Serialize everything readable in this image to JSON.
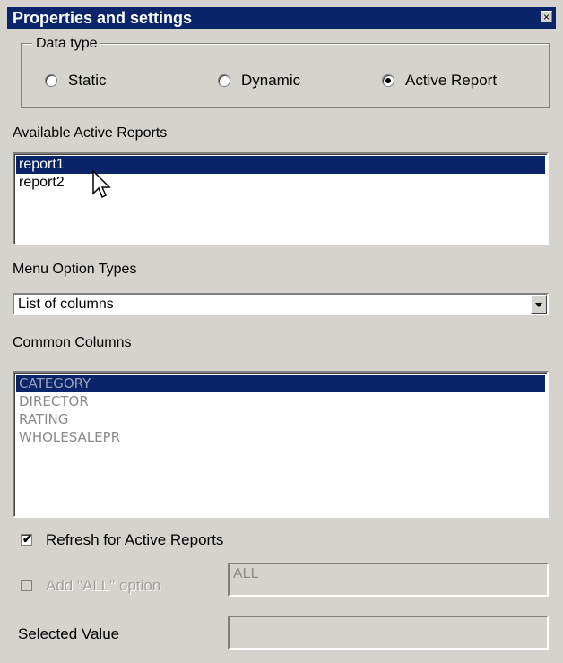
{
  "window": {
    "title": "Properties and settings",
    "close_glyph": "×"
  },
  "data_type": {
    "legend": "Data type",
    "options": [
      {
        "label": "Static",
        "selected": false
      },
      {
        "label": "Dynamic",
        "selected": false
      },
      {
        "label": "Active Report",
        "selected": true
      }
    ]
  },
  "available_reports": {
    "label": "Available Active Reports",
    "items": [
      "report1",
      "report2"
    ],
    "selected_index": 0
  },
  "menu_option_types": {
    "label": "Menu Option Types",
    "value": "List of columns"
  },
  "common_columns": {
    "label": "Common Columns",
    "items": [
      "CATEGORY",
      "DIRECTOR",
      "RATING",
      "WHOLESALEPR"
    ],
    "selected_index": 0
  },
  "refresh_checkbox": {
    "label": "Refresh for Active Reports",
    "checked": true
  },
  "add_all": {
    "label": "Add \"ALL\" option",
    "checked": false,
    "enabled": false,
    "field_value": "ALL"
  },
  "selected_value": {
    "label": "Selected Value",
    "value": ""
  },
  "colors": {
    "title_bar": "#0a246a",
    "panel": "#d6d3ce",
    "selection": "#0a246a"
  }
}
